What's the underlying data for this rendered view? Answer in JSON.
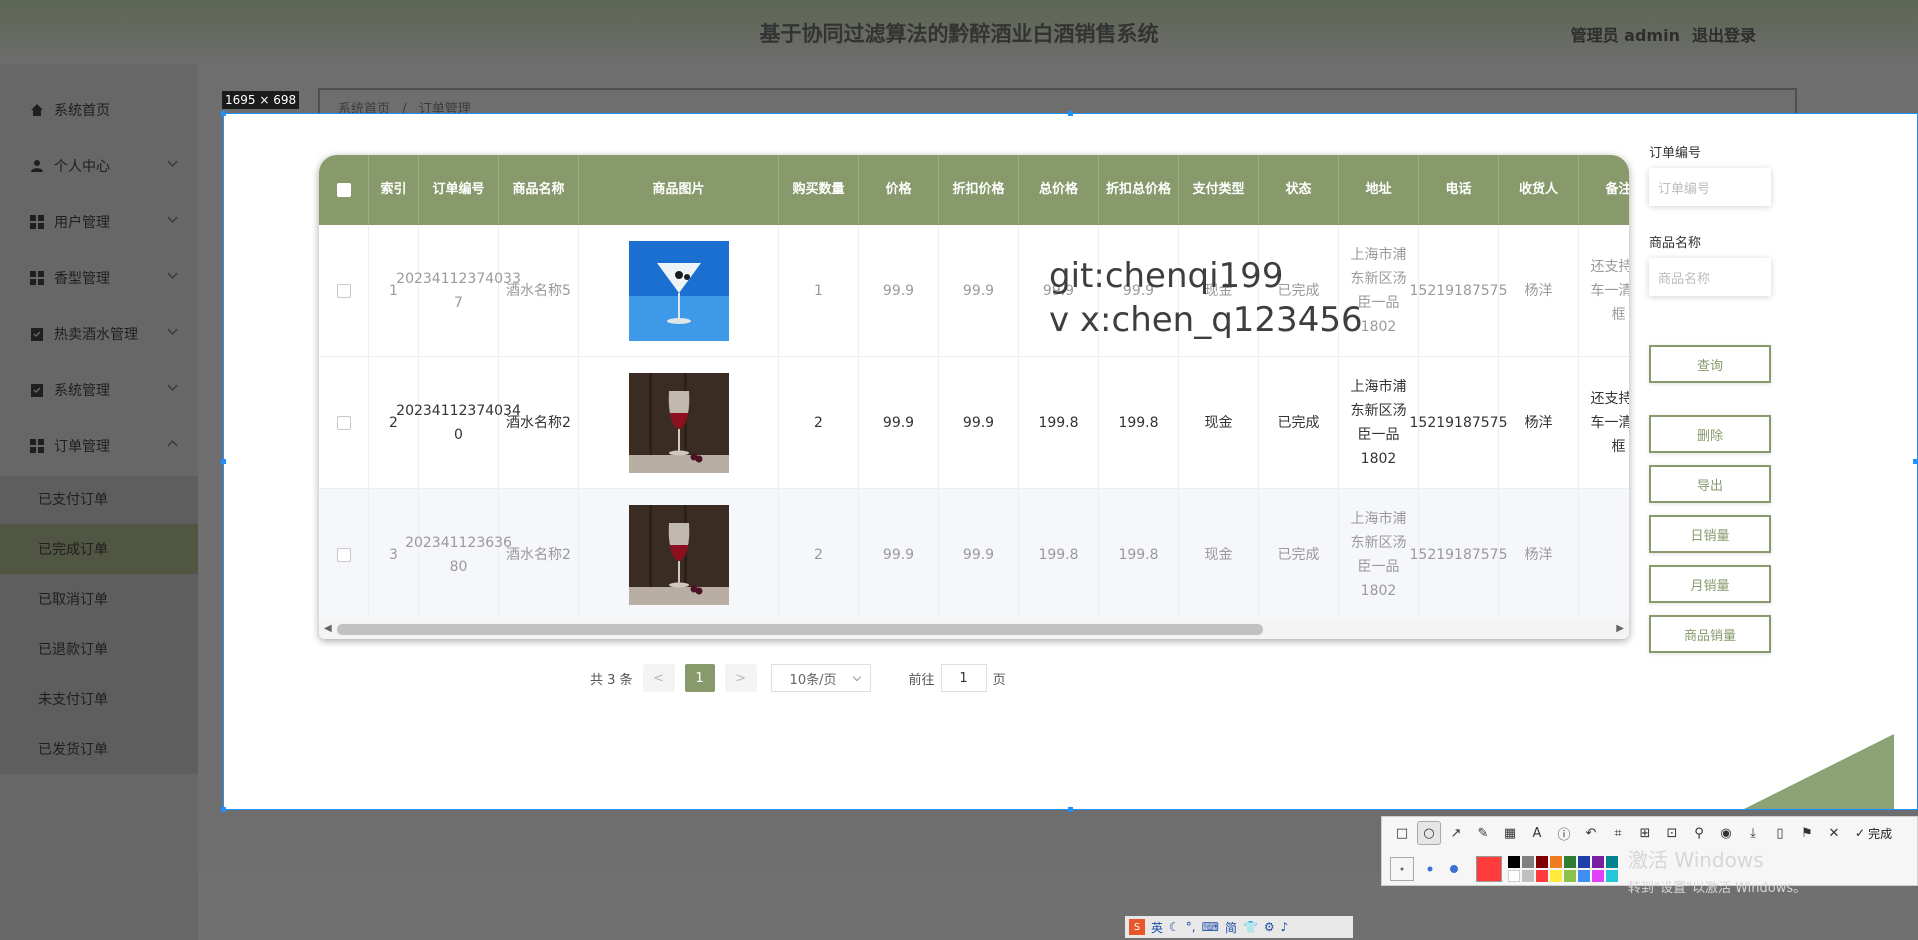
{
  "header": {
    "title": "基于协同过滤算法的黔醉酒业白酒销售系统",
    "admin_label": "管理员 admin",
    "logout_label": "退出登录"
  },
  "sidebar": {
    "items": [
      {
        "label": "系统首页",
        "icon": "home-icon"
      },
      {
        "label": "个人中心",
        "icon": "user-icon"
      },
      {
        "label": "用户管理",
        "icon": "grid-icon"
      },
      {
        "label": "香型管理",
        "icon": "grid-icon"
      },
      {
        "label": "热卖酒水管理",
        "icon": "checklist-icon"
      },
      {
        "label": "系统管理",
        "icon": "checklist-icon"
      },
      {
        "label": "订单管理",
        "icon": "grid-icon"
      }
    ],
    "sub_items": [
      "已支付订单",
      "已完成订单",
      "已取消订单",
      "已退款订单",
      "未支付订单",
      "已发货订单"
    ],
    "active_sub": "已完成订单"
  },
  "breadcrumb": {
    "home": "系统首页",
    "separator": "/",
    "current": "订单管理"
  },
  "capture": {
    "size_label": "1695 × 698"
  },
  "table": {
    "headers": [
      "索引",
      "订单编号",
      "商品名称",
      "商品图片",
      "购买数量",
      "价格",
      "折扣价格",
      "总价格",
      "折扣总价格",
      "支付类型",
      "状态",
      "地址",
      "电话",
      "收货人",
      "备注"
    ],
    "rows": [
      {
        "index": "1",
        "order_no": "20234112374033 7",
        "name": "酒水名称5",
        "qty": "1",
        "price": "99.9",
        "discount_price": "99.9",
        "total": "99.9",
        "discount_total": "99.9",
        "pay_type": "现金",
        "status": "已完成",
        "address": "上海市浦东新区汤臣一品1802",
        "phone": "15219187575",
        "receiver": "杨洋",
        "remark": "还支持物车一清空框"
      },
      {
        "index": "2",
        "order_no": "20234112374034 0",
        "name": "酒水名称2",
        "qty": "2",
        "price": "99.9",
        "discount_price": "99.9",
        "total": "199.8",
        "discount_total": "199.8",
        "pay_type": "现金",
        "status": "已完成",
        "address": "上海市浦东新区汤臣一品1802",
        "phone": "15219187575",
        "receiver": "杨洋",
        "remark": "还支持物车一清空框"
      },
      {
        "index": "3",
        "order_no": "202341123636 80",
        "name": "酒水名称2",
        "qty": "2",
        "price": "99.9",
        "discount_price": "99.9",
        "total": "199.8",
        "discount_total": "199.8",
        "pay_type": "现金",
        "status": "已完成",
        "address": "上海市浦东新区汤臣一品1802",
        "phone": "15219187575",
        "receiver": "杨洋",
        "remark": ""
      }
    ]
  },
  "watermark": {
    "line1": "git:chenqi199",
    "line2": "v x:chen_q123456"
  },
  "pagination": {
    "total_text": "共 3 条",
    "prev": "<",
    "page": "1",
    "next": ">",
    "page_size": "10条/页",
    "goto_label": "前往",
    "goto_value": "1",
    "page_suffix": "页"
  },
  "search": {
    "order_no_label": "订单编号",
    "order_no_placeholder": "订单编号",
    "product_label": "商品名称",
    "product_placeholder": "商品名称",
    "query_button": "查询"
  },
  "actions": {
    "delete": "删除",
    "export": "导出",
    "daily": "日销量",
    "monthly": "月销量",
    "product_sales": "商品销量"
  },
  "toolbar": {
    "done_label": "完成",
    "current_color": "#ff3b3b"
  },
  "activation": {
    "title": "激活 Windows",
    "subtitle": "转到\"设置\"以激活 Windows。"
  },
  "ime": {
    "lang": "英",
    "simplified": "简"
  },
  "colors": {
    "accent": "#889a6c",
    "selection_border": "#1e90ff"
  }
}
